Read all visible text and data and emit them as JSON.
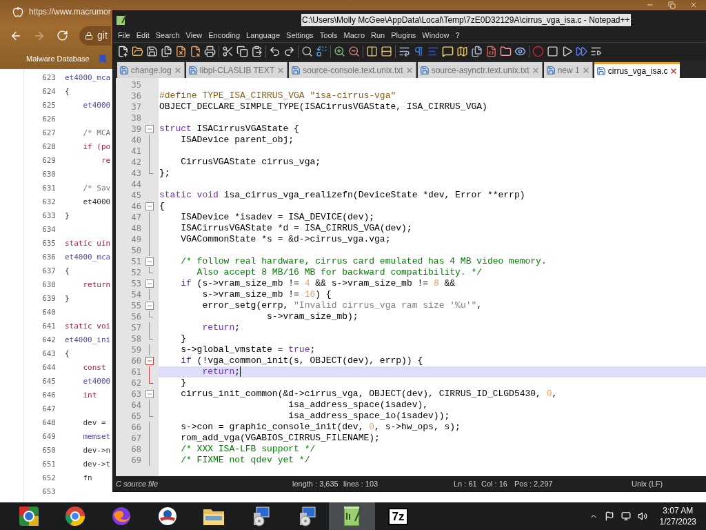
{
  "browser": {
    "tab_url": "https://www.macrumor",
    "address": "git",
    "bookmark": "Malware Database",
    "code_lines": [
      {
        "number": "623",
        "text": "et4000_mca",
        "kind": "func"
      },
      {
        "number": "624",
        "text": "{",
        "kind": "plain"
      },
      {
        "number": "625",
        "text": "    et4000",
        "kind": "func"
      },
      {
        "number": "626"
      },
      {
        "number": "627",
        "text": "    /* MCA",
        "kind": "comment"
      },
      {
        "number": "628",
        "text": "    if (po",
        "kind": "keyword"
      },
      {
        "number": "629",
        "text": "        re",
        "kind": "keyword"
      },
      {
        "number": "630"
      },
      {
        "number": "631",
        "text": "    /* Sav",
        "kind": "comment"
      },
      {
        "number": "632",
        "text": "    et4000",
        "kind": "plain"
      },
      {
        "number": "633",
        "text": "}",
        "kind": "plain"
      },
      {
        "number": "634"
      },
      {
        "number": "635",
        "text": "static uin",
        "kind": "keyword"
      },
      {
        "number": "636",
        "text": "et4000_mca",
        "kind": "func"
      },
      {
        "number": "637",
        "text": "{",
        "kind": "plain"
      },
      {
        "number": "638",
        "text": "    return",
        "kind": "keyword"
      },
      {
        "number": "639",
        "text": "}",
        "kind": "plain"
      },
      {
        "number": "640"
      },
      {
        "number": "641",
        "text": "static voi",
        "kind": "keyword"
      },
      {
        "number": "642",
        "text": "et4000_ini",
        "kind": "func"
      },
      {
        "number": "643",
        "text": "{",
        "kind": "plain"
      },
      {
        "number": "644",
        "text": "    const",
        "kind": "keyword"
      },
      {
        "number": "645",
        "text": "    et4000",
        "kind": "func"
      },
      {
        "number": "646",
        "text": "    int",
        "kind": "keyword"
      },
      {
        "number": "647"
      },
      {
        "number": "648",
        "text": "    dev =",
        "kind": "plain"
      },
      {
        "number": "649",
        "text": "    memset",
        "kind": "func"
      },
      {
        "number": "650",
        "text": "    dev->n",
        "kind": "plain"
      },
      {
        "number": "651",
        "text": "    dev->t",
        "kind": "plain"
      },
      {
        "number": "652",
        "text": "    fn",
        "kind": "plain"
      },
      {
        "number": "653"
      }
    ]
  },
  "window": {
    "title": "C:\\Users\\Molly McGee\\AppData\\Local\\Temp\\7zE0D32129A\\cirrus_vga_isa.c - Notepad++",
    "menu": [
      "File",
      "Edit",
      "Search",
      "View",
      "Encoding",
      "Language",
      "Settings",
      "Tools",
      "Macro",
      "Run",
      "Plugins",
      "Window",
      "?"
    ],
    "tabs": [
      {
        "label": "change.log",
        "selected": false
      },
      {
        "label": "libpl-CLASLIB TEXT",
        "selected": false
      },
      {
        "label": "source-console.text.unix.txt",
        "selected": false
      },
      {
        "label": "source-asynctr.text.unix.txt",
        "selected": false
      },
      {
        "label": "new 1",
        "selected": false
      },
      {
        "label": "cirrus_vga_isa.c",
        "selected": true
      }
    ],
    "editor": {
      "lines": [
        {
          "number": "35",
          "kind": "plain",
          "current": false
        },
        {
          "number": "36",
          "kind": "plain",
          "current": false,
          "segments": [
            {
              "kind": "preprocessor",
              "text": "#define TYPE_ISA_CIRRUS_VGA \"isa-cirrus-vga\""
            }
          ]
        },
        {
          "number": "37",
          "kind": "plain",
          "current": false,
          "segments": [
            {
              "kind": "plain",
              "text": "OBJECT_DECLARE_SIMPLE_TYPE(ISACirrusVGAState, ISA_CIRRUS_VGA)"
            }
          ]
        },
        {
          "number": "38",
          "kind": "plain",
          "current": false
        },
        {
          "number": "39",
          "kind": "fold-start",
          "fold_active": false,
          "current": false,
          "segments": [
            {
              "kind": "keyword",
              "text": "struct"
            },
            {
              "kind": "plain",
              "text": " ISACirrusVGAState {"
            }
          ]
        },
        {
          "number": "40",
          "kind": "fold-body",
          "fold_active": false,
          "current": false,
          "segments": [
            {
              "kind": "plain",
              "text": "    ISADevice parent_obj;"
            }
          ]
        },
        {
          "number": "41",
          "kind": "fold-body",
          "fold_active": false,
          "current": false
        },
        {
          "number": "42",
          "kind": "fold-body",
          "fold_active": false,
          "current": false,
          "segments": [
            {
              "kind": "plain",
              "text": "    CirrusVGAState cirrus_vga;"
            }
          ]
        },
        {
          "number": "43",
          "kind": "fold-end",
          "fold_active": false,
          "current": false,
          "segments": [
            {
              "kind": "plain",
              "text": "};"
            }
          ]
        },
        {
          "number": "44",
          "kind": "plain",
          "current": false
        },
        {
          "number": "45",
          "kind": "plain",
          "current": false,
          "segments": [
            {
              "kind": "keyword",
              "text": "static void"
            },
            {
              "kind": "plain",
              "text": " isa_cirrus_vga_realizefn(DeviceState *dev, Error **errp)"
            }
          ]
        },
        {
          "number": "46",
          "kind": "fold-start",
          "fold_active": false,
          "current": false,
          "segments": [
            {
              "kind": "plain",
              "text": "{"
            }
          ]
        },
        {
          "number": "47",
          "kind": "fold-body",
          "fold_active": false,
          "current": false,
          "segments": [
            {
              "kind": "plain",
              "text": "    ISADevice *isadev = ISA_DEVICE(dev);"
            }
          ]
        },
        {
          "number": "48",
          "kind": "fold-body",
          "fold_active": false,
          "current": false,
          "segments": [
            {
              "kind": "plain",
              "text": "    ISACirrusVGAState *d = ISA_CIRRUS_VGA(dev);"
            }
          ]
        },
        {
          "number": "49",
          "kind": "fold-body",
          "fold_active": false,
          "current": false,
          "segments": [
            {
              "kind": "plain",
              "text": "    VGACommonState *s = &d->cirrus_vga.vga;"
            }
          ]
        },
        {
          "number": "50",
          "kind": "fold-body",
          "fold_active": false,
          "current": false
        },
        {
          "number": "51",
          "kind": "fold-start",
          "fold_active": false,
          "current": false,
          "segments": [
            {
              "kind": "comment",
              "text": "    /* follow real hardware, cirrus card emulated has 4 MB video memory."
            }
          ]
        },
        {
          "number": "52",
          "kind": "fold-end",
          "fold_active": false,
          "current": false,
          "segments": [
            {
              "kind": "comment",
              "text": "       Also accept 8 MB/16 MB for backward compatibility. */"
            }
          ]
        },
        {
          "number": "53",
          "kind": "fold-start",
          "fold_active": false,
          "current": false,
          "segments": [
            {
              "kind": "keyword",
              "text": "    if"
            },
            {
              "kind": "plain",
              "text": " (s->vram_size_mb != "
            },
            {
              "kind": "number",
              "text": "4"
            },
            {
              "kind": "plain",
              "text": " && s->vram_size_mb != "
            },
            {
              "kind": "number",
              "text": "8"
            },
            {
              "kind": "plain",
              "text": " &&"
            }
          ]
        },
        {
          "number": "54",
          "kind": "fold-body",
          "fold_active": false,
          "current": false,
          "segments": [
            {
              "kind": "plain",
              "text": "        s->vram_size_mb != "
            },
            {
              "kind": "number",
              "text": "16"
            },
            {
              "kind": "plain",
              "text": ") {"
            }
          ]
        },
        {
          "number": "55",
          "kind": "fold-start",
          "fold_active": false,
          "current": false,
          "segments": [
            {
              "kind": "plain",
              "text": "        error_setg(errp, "
            },
            {
              "kind": "string",
              "text": "\"Invalid cirrus_vga ram size '%u'\""
            },
            {
              "kind": "plain",
              "text": ","
            }
          ]
        },
        {
          "number": "56",
          "kind": "fold-end",
          "fold_active": false,
          "current": false,
          "segments": [
            {
              "kind": "plain",
              "text": "                    s->vram_size_mb);"
            }
          ]
        },
        {
          "number": "57",
          "kind": "fold-body",
          "fold_active": false,
          "current": false,
          "segments": [
            {
              "kind": "keyword",
              "text": "        return"
            },
            {
              "kind": "plain",
              "text": ";"
            }
          ]
        },
        {
          "number": "58",
          "kind": "fold-end",
          "fold_active": false,
          "current": false,
          "segments": [
            {
              "kind": "plain",
              "text": "    }"
            }
          ]
        },
        {
          "number": "59",
          "kind": "fold-body",
          "fold_active": false,
          "current": false,
          "segments": [
            {
              "kind": "plain",
              "text": "    s->global_vmstate = "
            },
            {
              "kind": "keyword",
              "text": "true"
            },
            {
              "kind": "plain",
              "text": ";"
            }
          ]
        },
        {
          "number": "60",
          "kind": "fold-start",
          "fold_active": true,
          "current": false,
          "segments": [
            {
              "kind": "keyword",
              "text": "    if"
            },
            {
              "kind": "plain",
              "text": " (!vga_common_init(s, OBJECT(dev), errp)) {"
            }
          ]
        },
        {
          "number": "61",
          "kind": "fold-body",
          "fold_active": true,
          "current": true,
          "segments": [
            {
              "kind": "keyword",
              "text": "        return"
            },
            {
              "kind": "plain",
              "text": ";"
            }
          ]
        },
        {
          "number": "62",
          "kind": "fold-end",
          "fold_active": true,
          "current": false,
          "segments": [
            {
              "kind": "plain",
              "text": "    }"
            }
          ]
        },
        {
          "number": "63",
          "kind": "fold-start",
          "fold_active": false,
          "current": false,
          "segments": [
            {
              "kind": "plain",
              "text": "    cirrus_init_common(&d->cirrus_vga, OBJECT(dev), CIRRUS_ID_CLGD5430, "
            },
            {
              "kind": "number",
              "text": "0"
            },
            {
              "kind": "plain",
              "text": ","
            }
          ]
        },
        {
          "number": "64",
          "kind": "fold-body",
          "fold_active": false,
          "current": false,
          "segments": [
            {
              "kind": "plain",
              "text": "                        isa_address_space(isadev),"
            }
          ]
        },
        {
          "number": "65",
          "kind": "fold-end",
          "fold_active": false,
          "current": false,
          "segments": [
            {
              "kind": "plain",
              "text": "                        isa_address_space_io(isadev));"
            }
          ]
        },
        {
          "number": "66",
          "kind": "fold-body",
          "fold_active": false,
          "current": false,
          "segments": [
            {
              "kind": "plain",
              "text": "    s->con = graphic_console_init(dev, "
            },
            {
              "kind": "number",
              "text": "0"
            },
            {
              "kind": "plain",
              "text": ", s->hw_ops, s);"
            }
          ]
        },
        {
          "number": "67",
          "kind": "fold-body",
          "fold_active": false,
          "current": false,
          "segments": [
            {
              "kind": "plain",
              "text": "    rom_add_vga(VGABIOS_CIRRUS_FILENAME);"
            }
          ]
        },
        {
          "number": "68",
          "kind": "fold-body",
          "fold_active": false,
          "current": false,
          "segments": [
            {
              "kind": "comment",
              "text": "    /* XXX ISA-LFB support */"
            }
          ]
        },
        {
          "number": "69",
          "kind": "fold-body",
          "fold_active": false,
          "current": false,
          "segments": [
            {
              "kind": "comment",
              "text": "    /* FIXME not qdev yet */"
            }
          ]
        }
      ]
    },
    "status_bar": {
      "file_type": "C source file",
      "length": "length : 3,635",
      "lines": "lines : 103",
      "line": "Ln : 61",
      "column": "Col : 16",
      "position": "Pos : 2,297",
      "eol": "Unix (LF)"
    }
  },
  "taskbar": {
    "items": [
      {
        "kind": "browser-square",
        "selected": false
      },
      {
        "kind": "ring",
        "selected": false
      },
      {
        "kind": "fox",
        "selected": false
      },
      {
        "kind": "round-logo",
        "selected": false
      },
      {
        "kind": "folder",
        "selected": false
      },
      {
        "kind": "setup",
        "selected": false
      },
      {
        "kind": "setup",
        "selected": false
      },
      {
        "kind": "notepad",
        "selected": true
      },
      {
        "kind": "archive",
        "label": "7z",
        "selected": false
      }
    ],
    "time": "3:07 AM",
    "date": "1/27/2023"
  }
}
